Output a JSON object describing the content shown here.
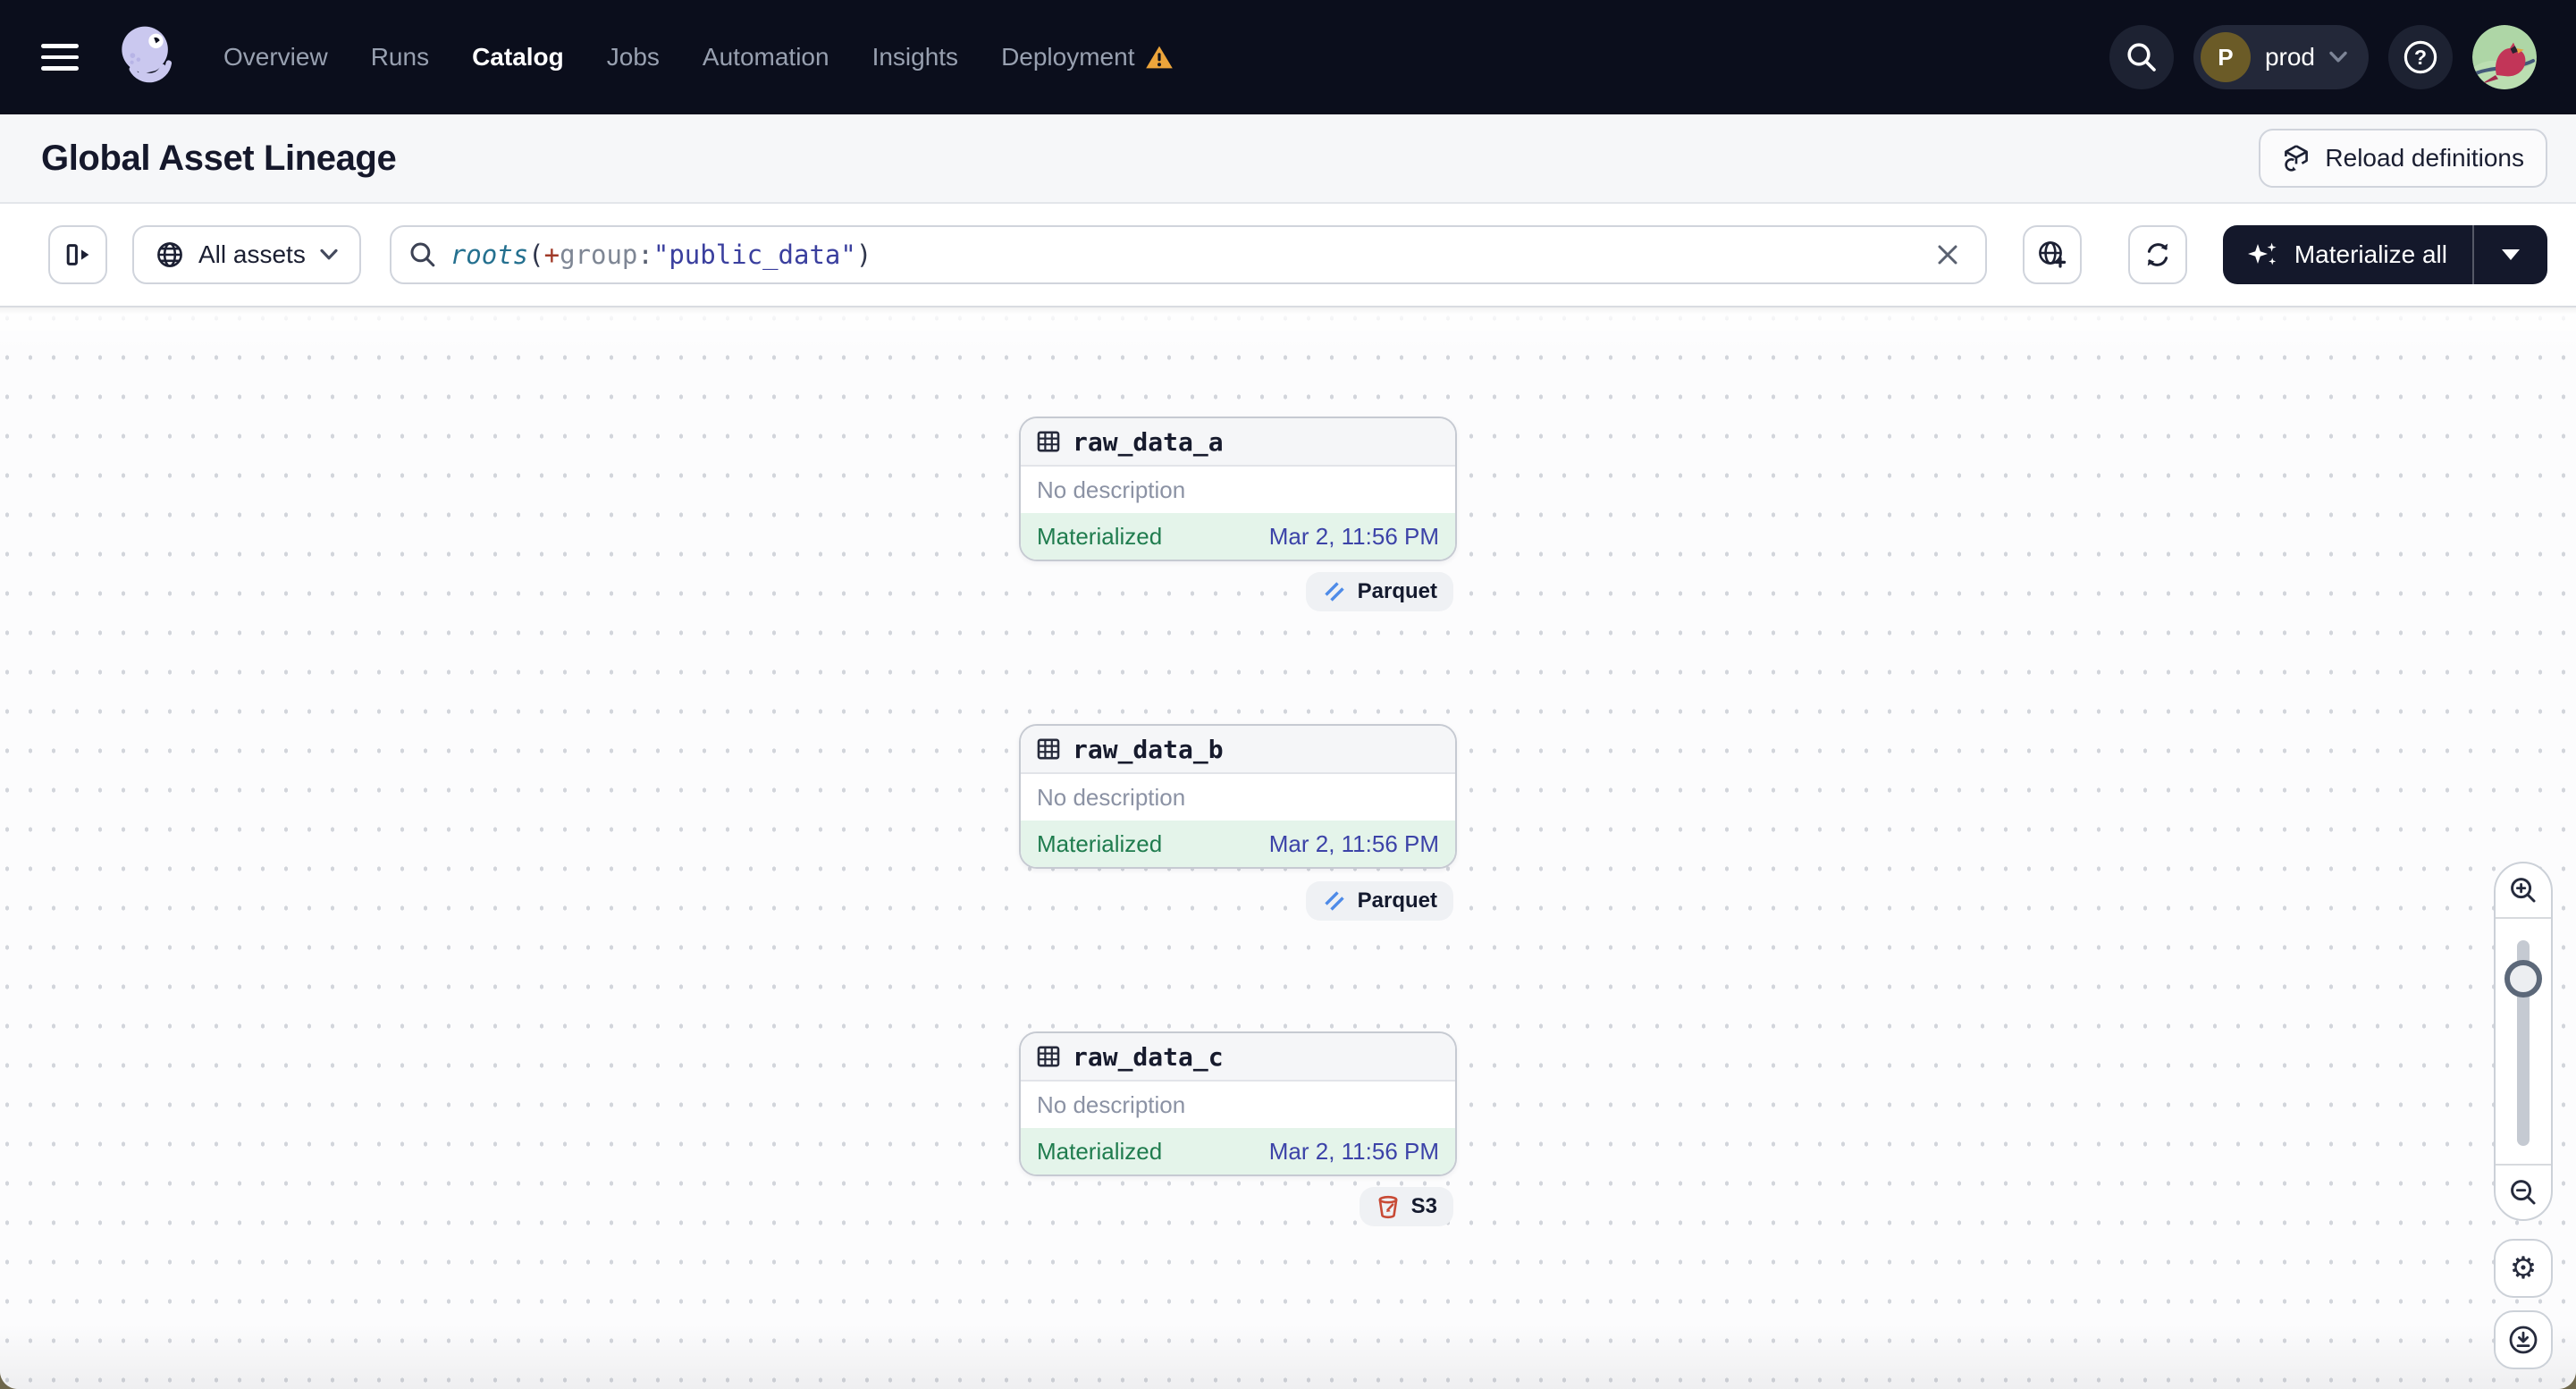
{
  "nav": {
    "items": [
      {
        "label": "Overview"
      },
      {
        "label": "Runs"
      },
      {
        "label": "Catalog",
        "active": true
      },
      {
        "label": "Jobs"
      },
      {
        "label": "Automation"
      },
      {
        "label": "Insights"
      },
      {
        "label": "Deployment",
        "warning": true
      }
    ],
    "environment": {
      "initial": "P",
      "name": "prod"
    }
  },
  "header": {
    "title": "Global Asset Lineage",
    "reload_label": "Reload definitions"
  },
  "toolbar": {
    "scope_label": "All assets",
    "query": {
      "function": "roots",
      "punct_open": "(",
      "operator": "+",
      "attribute": "group",
      "separator": ":",
      "value": "\"public_data\"",
      "punct_close": ")"
    },
    "materialize_label": "Materialize all"
  },
  "graph": {
    "nodes": [
      {
        "name": "raw_data_a",
        "description": "No description",
        "status": "Materialized",
        "timestamp": "Mar 2, 11:56 PM",
        "tag": "Parquet"
      },
      {
        "name": "raw_data_b",
        "description": "No description",
        "status": "Materialized",
        "timestamp": "Mar 2, 11:56 PM",
        "tag": "Parquet"
      },
      {
        "name": "raw_data_c",
        "description": "No description",
        "status": "Materialized",
        "timestamp": "Mar 2, 11:56 PM",
        "tag": "S3"
      }
    ]
  },
  "colors": {
    "nav_background": "#0b0e1c",
    "accent_dark_button": "#14182b",
    "status_materialized_text": "#1f7c4e",
    "status_materialized_background": "#e4f4ea",
    "timestamp_text": "#3c43a8",
    "warning": "#eda53b",
    "parquet_blue": "#4e8be8",
    "s3_red": "#c84a35"
  }
}
